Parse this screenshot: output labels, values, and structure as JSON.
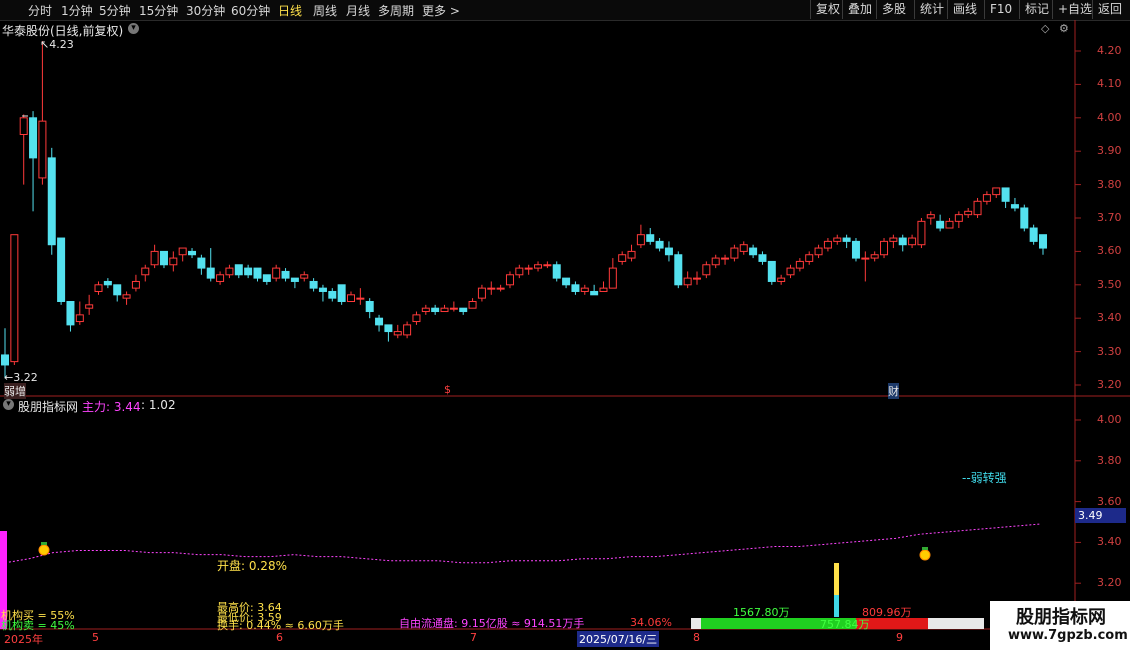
{
  "toolbar": {
    "periods": [
      {
        "label": "分时"
      },
      {
        "label": "1分钟"
      },
      {
        "label": "5分钟"
      },
      {
        "label": "15分钟"
      },
      {
        "label": "30分钟"
      },
      {
        "label": "60分钟"
      },
      {
        "label": "日线",
        "active": true
      },
      {
        "label": "周线"
      },
      {
        "label": "月线"
      },
      {
        "label": "多周期"
      },
      {
        "label": "更多 >"
      }
    ],
    "right": [
      "复权",
      "叠加",
      "多股",
      "统计",
      "画线",
      "F10",
      "标记",
      "+自选",
      "返回"
    ]
  },
  "main_panel": {
    "title": "华泰股份(日线,前复权)",
    "high_label": "4.23",
    "low_label": "3.22",
    "markers": [
      "弱增",
      "$",
      "财"
    ],
    "y_ticks": [
      "4.20",
      "4.10",
      "4.00",
      "3.90",
      "3.80",
      "3.70",
      "3.60",
      "3.50",
      "3.40",
      "3.30",
      "3.20"
    ]
  },
  "indicator_panel": {
    "name": "股朋指标网",
    "main_label": "主力: 3.44",
    "main_value2": ": 1.02",
    "signal_text": "--弱转强",
    "current_value": "3.49",
    "y_ticks": [
      "4.00",
      "3.80",
      "3.60",
      "3.40",
      "3.20"
    ],
    "open_pct": "开盘: 0.28%",
    "inst_buy": "机构买 = 55%",
    "inst_sell": "机构卖 = 45%",
    "highest": "最高价: 3.64",
    "lowest": "最低价: 3.59",
    "turnover": "换手: 0.44% ≈ 6.60万手",
    "free_float": "自由流通盘: 9.15亿股 ≈ 914.51万手",
    "pct_34": "34.06%",
    "green_vol": "1567.80万",
    "red_vol": "809.96万",
    "mid_vol": "757.84万"
  },
  "dates": [
    "2025年",
    "5",
    "6",
    "7",
    "2025/07/16/三",
    "8",
    "9"
  ],
  "watermark": {
    "cn": "股朋指标网",
    "url": "www.7gpzb.com"
  },
  "colors": {
    "up": "#ff3a3a",
    "down": "#54e1ef",
    "bg": "#000000",
    "magenta": "#ff44ff",
    "yellow": "#ffe14a"
  },
  "chart_data": {
    "type": "candlestick",
    "ylim": [
      3.18,
      4.28
    ],
    "candles": [
      [
        3.29,
        3.26,
        3.37,
        3.22
      ],
      [
        3.27,
        3.65,
        3.65,
        3.26
      ],
      [
        3.95,
        4.0,
        4.01,
        3.8
      ],
      [
        4.0,
        3.88,
        4.02,
        3.72
      ],
      [
        3.82,
        3.99,
        4.23,
        3.8
      ],
      [
        3.88,
        3.62,
        3.91,
        3.59
      ],
      [
        3.64,
        3.45,
        3.64,
        3.44
      ],
      [
        3.45,
        3.38,
        3.45,
        3.36
      ],
      [
        3.39,
        3.41,
        3.45,
        3.38
      ],
      [
        3.43,
        3.44,
        3.47,
        3.41
      ],
      [
        3.48,
        3.5,
        3.51,
        3.47
      ],
      [
        3.51,
        3.5,
        3.52,
        3.49
      ],
      [
        3.5,
        3.47,
        3.5,
        3.45
      ],
      [
        3.46,
        3.47,
        3.48,
        3.44
      ],
      [
        3.49,
        3.51,
        3.53,
        3.48
      ],
      [
        3.53,
        3.55,
        3.56,
        3.51
      ],
      [
        3.56,
        3.6,
        3.62,
        3.55
      ],
      [
        3.6,
        3.56,
        3.6,
        3.55
      ],
      [
        3.56,
        3.58,
        3.6,
        3.54
      ],
      [
        3.59,
        3.61,
        3.61,
        3.57
      ],
      [
        3.6,
        3.59,
        3.61,
        3.58
      ],
      [
        3.58,
        3.55,
        3.59,
        3.53
      ],
      [
        3.55,
        3.52,
        3.61,
        3.51
      ],
      [
        3.51,
        3.53,
        3.54,
        3.5
      ],
      [
        3.53,
        3.55,
        3.56,
        3.52
      ],
      [
        3.56,
        3.53,
        3.56,
        3.52
      ],
      [
        3.55,
        3.53,
        3.56,
        3.52
      ],
      [
        3.55,
        3.52,
        3.55,
        3.51
      ],
      [
        3.53,
        3.51,
        3.53,
        3.5
      ],
      [
        3.52,
        3.55,
        3.56,
        3.51
      ],
      [
        3.54,
        3.52,
        3.55,
        3.51
      ],
      [
        3.52,
        3.51,
        3.52,
        3.49
      ],
      [
        3.52,
        3.53,
        3.54,
        3.51
      ],
      [
        3.51,
        3.49,
        3.52,
        3.48
      ],
      [
        3.49,
        3.48,
        3.5,
        3.45
      ],
      [
        3.48,
        3.46,
        3.49,
        3.45
      ],
      [
        3.5,
        3.45,
        3.5,
        3.44
      ],
      [
        3.45,
        3.47,
        3.48,
        3.45
      ],
      [
        3.46,
        3.46,
        3.49,
        3.44
      ],
      [
        3.45,
        3.42,
        3.46,
        3.4
      ],
      [
        3.4,
        3.38,
        3.41,
        3.36
      ],
      [
        3.38,
        3.36,
        3.38,
        3.33
      ],
      [
        3.35,
        3.36,
        3.38,
        3.34
      ],
      [
        3.35,
        3.38,
        3.39,
        3.34
      ],
      [
        3.39,
        3.41,
        3.42,
        3.38
      ],
      [
        3.42,
        3.43,
        3.44,
        3.41
      ],
      [
        3.43,
        3.42,
        3.44,
        3.41
      ],
      [
        3.42,
        3.43,
        3.44,
        3.42
      ],
      [
        3.43,
        3.43,
        3.45,
        3.42
      ],
      [
        3.43,
        3.42,
        3.43,
        3.41
      ],
      [
        3.43,
        3.45,
        3.46,
        3.43
      ],
      [
        3.46,
        3.49,
        3.5,
        3.45
      ],
      [
        3.49,
        3.49,
        3.51,
        3.47
      ],
      [
        3.49,
        3.49,
        3.5,
        3.48
      ],
      [
        3.5,
        3.53,
        3.54,
        3.49
      ],
      [
        3.53,
        3.55,
        3.56,
        3.52
      ],
      [
        3.55,
        3.55,
        3.56,
        3.53
      ],
      [
        3.55,
        3.56,
        3.57,
        3.54
      ],
      [
        3.56,
        3.56,
        3.57,
        3.55
      ],
      [
        3.56,
        3.52,
        3.57,
        3.51
      ],
      [
        3.52,
        3.5,
        3.52,
        3.49
      ],
      [
        3.5,
        3.48,
        3.51,
        3.47
      ],
      [
        3.48,
        3.49,
        3.5,
        3.47
      ],
      [
        3.48,
        3.47,
        3.5,
        3.47
      ],
      [
        3.48,
        3.49,
        3.51,
        3.48
      ],
      [
        3.49,
        3.55,
        3.58,
        3.49
      ],
      [
        3.57,
        3.59,
        3.6,
        3.56
      ],
      [
        3.58,
        3.6,
        3.62,
        3.57
      ],
      [
        3.62,
        3.65,
        3.68,
        3.61
      ],
      [
        3.65,
        3.63,
        3.67,
        3.62
      ],
      [
        3.63,
        3.61,
        3.64,
        3.6
      ],
      [
        3.61,
        3.59,
        3.63,
        3.57
      ],
      [
        3.59,
        3.5,
        3.6,
        3.49
      ],
      [
        3.5,
        3.52,
        3.54,
        3.49
      ],
      [
        3.52,
        3.52,
        3.54,
        3.5
      ],
      [
        3.53,
        3.56,
        3.57,
        3.52
      ],
      [
        3.56,
        3.58,
        3.59,
        3.55
      ],
      [
        3.58,
        3.58,
        3.59,
        3.56
      ],
      [
        3.58,
        3.61,
        3.62,
        3.57
      ],
      [
        3.6,
        3.62,
        3.63,
        3.59
      ],
      [
        3.61,
        3.59,
        3.62,
        3.58
      ],
      [
        3.59,
        3.57,
        3.6,
        3.56
      ],
      [
        3.57,
        3.51,
        3.57,
        3.5
      ],
      [
        3.51,
        3.52,
        3.53,
        3.5
      ],
      [
        3.53,
        3.55,
        3.56,
        3.52
      ],
      [
        3.55,
        3.57,
        3.58,
        3.54
      ],
      [
        3.57,
        3.59,
        3.6,
        3.56
      ],
      [
        3.59,
        3.61,
        3.62,
        3.58
      ],
      [
        3.61,
        3.63,
        3.64,
        3.6
      ],
      [
        3.63,
        3.64,
        3.65,
        3.62
      ],
      [
        3.64,
        3.63,
        3.65,
        3.61
      ],
      [
        3.63,
        3.58,
        3.64,
        3.57
      ],
      [
        3.58,
        3.58,
        3.6,
        3.51
      ],
      [
        3.58,
        3.59,
        3.6,
        3.57
      ],
      [
        3.59,
        3.63,
        3.64,
        3.58
      ],
      [
        3.63,
        3.64,
        3.65,
        3.61
      ],
      [
        3.64,
        3.62,
        3.65,
        3.6
      ],
      [
        3.62,
        3.64,
        3.65,
        3.61
      ],
      [
        3.62,
        3.69,
        3.7,
        3.61
      ],
      [
        3.7,
        3.71,
        3.72,
        3.68
      ],
      [
        3.69,
        3.67,
        3.71,
        3.66
      ],
      [
        3.67,
        3.69,
        3.7,
        3.67
      ],
      [
        3.69,
        3.71,
        3.72,
        3.67
      ],
      [
        3.71,
        3.72,
        3.73,
        3.7
      ],
      [
        3.71,
        3.75,
        3.76,
        3.7
      ],
      [
        3.75,
        3.77,
        3.78,
        3.74
      ],
      [
        3.77,
        3.79,
        3.79,
        3.76
      ],
      [
        3.79,
        3.75,
        3.79,
        3.73
      ],
      [
        3.74,
        3.73,
        3.76,
        3.72
      ],
      [
        3.73,
        3.67,
        3.74,
        3.66
      ],
      [
        3.67,
        3.63,
        3.68,
        3.62
      ],
      [
        3.65,
        3.61,
        3.65,
        3.59
      ]
    ],
    "main_line_ylim": [
      3.15,
      4.1
    ],
    "main_line": [
      3.3,
      3.32,
      3.35,
      3.36,
      3.36,
      3.36,
      3.35,
      3.35,
      3.34,
      3.34,
      3.33,
      3.33,
      3.34,
      3.33,
      3.33,
      3.32,
      3.31,
      3.31,
      3.31,
      3.3,
      3.3,
      3.31,
      3.31,
      3.31,
      3.32,
      3.32,
      3.33,
      3.33,
      3.34,
      3.35,
      3.36,
      3.37,
      3.38,
      3.38,
      3.39,
      3.4,
      3.41,
      3.42,
      3.44,
      3.45,
      3.46,
      3.47,
      3.48,
      3.49
    ]
  }
}
